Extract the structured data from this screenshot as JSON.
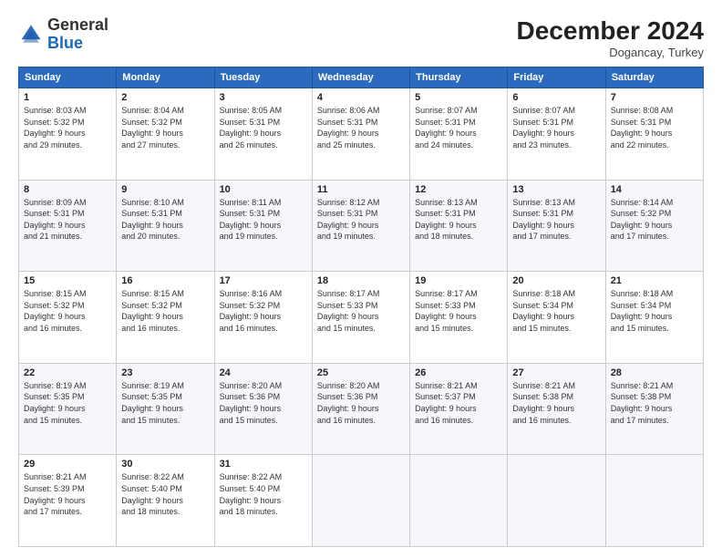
{
  "logo": {
    "line1": "General",
    "line2": "Blue"
  },
  "header": {
    "title": "December 2024",
    "subtitle": "Dogancay, Turkey"
  },
  "weekdays": [
    "Sunday",
    "Monday",
    "Tuesday",
    "Wednesday",
    "Thursday",
    "Friday",
    "Saturday"
  ],
  "weeks": [
    [
      {
        "day": "1",
        "info": "Sunrise: 8:03 AM\nSunset: 5:32 PM\nDaylight: 9 hours\nand 29 minutes."
      },
      {
        "day": "2",
        "info": "Sunrise: 8:04 AM\nSunset: 5:32 PM\nDaylight: 9 hours\nand 27 minutes."
      },
      {
        "day": "3",
        "info": "Sunrise: 8:05 AM\nSunset: 5:31 PM\nDaylight: 9 hours\nand 26 minutes."
      },
      {
        "day": "4",
        "info": "Sunrise: 8:06 AM\nSunset: 5:31 PM\nDaylight: 9 hours\nand 25 minutes."
      },
      {
        "day": "5",
        "info": "Sunrise: 8:07 AM\nSunset: 5:31 PM\nDaylight: 9 hours\nand 24 minutes."
      },
      {
        "day": "6",
        "info": "Sunrise: 8:07 AM\nSunset: 5:31 PM\nDaylight: 9 hours\nand 23 minutes."
      },
      {
        "day": "7",
        "info": "Sunrise: 8:08 AM\nSunset: 5:31 PM\nDaylight: 9 hours\nand 22 minutes."
      }
    ],
    [
      {
        "day": "8",
        "info": "Sunrise: 8:09 AM\nSunset: 5:31 PM\nDaylight: 9 hours\nand 21 minutes."
      },
      {
        "day": "9",
        "info": "Sunrise: 8:10 AM\nSunset: 5:31 PM\nDaylight: 9 hours\nand 20 minutes."
      },
      {
        "day": "10",
        "info": "Sunrise: 8:11 AM\nSunset: 5:31 PM\nDaylight: 9 hours\nand 19 minutes."
      },
      {
        "day": "11",
        "info": "Sunrise: 8:12 AM\nSunset: 5:31 PM\nDaylight: 9 hours\nand 19 minutes."
      },
      {
        "day": "12",
        "info": "Sunrise: 8:13 AM\nSunset: 5:31 PM\nDaylight: 9 hours\nand 18 minutes."
      },
      {
        "day": "13",
        "info": "Sunrise: 8:13 AM\nSunset: 5:31 PM\nDaylight: 9 hours\nand 17 minutes."
      },
      {
        "day": "14",
        "info": "Sunrise: 8:14 AM\nSunset: 5:32 PM\nDaylight: 9 hours\nand 17 minutes."
      }
    ],
    [
      {
        "day": "15",
        "info": "Sunrise: 8:15 AM\nSunset: 5:32 PM\nDaylight: 9 hours\nand 16 minutes."
      },
      {
        "day": "16",
        "info": "Sunrise: 8:15 AM\nSunset: 5:32 PM\nDaylight: 9 hours\nand 16 minutes."
      },
      {
        "day": "17",
        "info": "Sunrise: 8:16 AM\nSunset: 5:32 PM\nDaylight: 9 hours\nand 16 minutes."
      },
      {
        "day": "18",
        "info": "Sunrise: 8:17 AM\nSunset: 5:33 PM\nDaylight: 9 hours\nand 15 minutes."
      },
      {
        "day": "19",
        "info": "Sunrise: 8:17 AM\nSunset: 5:33 PM\nDaylight: 9 hours\nand 15 minutes."
      },
      {
        "day": "20",
        "info": "Sunrise: 8:18 AM\nSunset: 5:34 PM\nDaylight: 9 hours\nand 15 minutes."
      },
      {
        "day": "21",
        "info": "Sunrise: 8:18 AM\nSunset: 5:34 PM\nDaylight: 9 hours\nand 15 minutes."
      }
    ],
    [
      {
        "day": "22",
        "info": "Sunrise: 8:19 AM\nSunset: 5:35 PM\nDaylight: 9 hours\nand 15 minutes."
      },
      {
        "day": "23",
        "info": "Sunrise: 8:19 AM\nSunset: 5:35 PM\nDaylight: 9 hours\nand 15 minutes."
      },
      {
        "day": "24",
        "info": "Sunrise: 8:20 AM\nSunset: 5:36 PM\nDaylight: 9 hours\nand 15 minutes."
      },
      {
        "day": "25",
        "info": "Sunrise: 8:20 AM\nSunset: 5:36 PM\nDaylight: 9 hours\nand 16 minutes."
      },
      {
        "day": "26",
        "info": "Sunrise: 8:21 AM\nSunset: 5:37 PM\nDaylight: 9 hours\nand 16 minutes."
      },
      {
        "day": "27",
        "info": "Sunrise: 8:21 AM\nSunset: 5:38 PM\nDaylight: 9 hours\nand 16 minutes."
      },
      {
        "day": "28",
        "info": "Sunrise: 8:21 AM\nSunset: 5:38 PM\nDaylight: 9 hours\nand 17 minutes."
      }
    ],
    [
      {
        "day": "29",
        "info": "Sunrise: 8:21 AM\nSunset: 5:39 PM\nDaylight: 9 hours\nand 17 minutes."
      },
      {
        "day": "30",
        "info": "Sunrise: 8:22 AM\nSunset: 5:40 PM\nDaylight: 9 hours\nand 18 minutes."
      },
      {
        "day": "31",
        "info": "Sunrise: 8:22 AM\nSunset: 5:40 PM\nDaylight: 9 hours\nand 18 minutes."
      },
      null,
      null,
      null,
      null
    ]
  ]
}
